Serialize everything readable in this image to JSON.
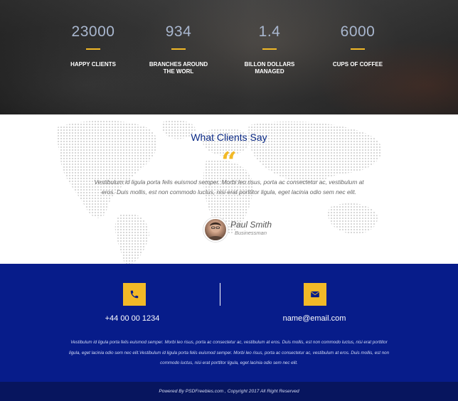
{
  "stats": [
    {
      "value": "23000",
      "label": "HAPPY CLIENTS"
    },
    {
      "value": "934",
      "label": "BRANCHES AROUND\nTHE WORL"
    },
    {
      "value": "1.4",
      "label": "BILLON DOLLARS\nMANAGED"
    },
    {
      "value": "6000",
      "label": "CUPS OF COFFEE"
    }
  ],
  "testimonials": {
    "title": "What Clients Say",
    "quote_icon": "quote-icon",
    "text": "Vestibulum id ligula porta felis euismod semper. Morbi leo risus, porta ac consectetur ac, vestibulum at eros. Duis mollis, est non commodo luctus, nisi erat porttitor ligula, eget lacinia odio sem nec elit.",
    "person": {
      "name": "Paul Smith",
      "role": "Businessman"
    }
  },
  "contact": {
    "phone": "+44 00 00 1234",
    "email": "name@email.com",
    "phone_icon": "phone-icon",
    "email_icon": "envelope-icon",
    "text": "Vestibulum id ligula porta felis euismod semper. Morbi leo risus, porta ac consectetur ac, vestibulum at eros. Duis mollis, est non commodo luctus, nisi erat porttitor ligula, eget lacinia odio sem nec elit.Vestibulum id ligula porta felis euismod semper. Morbi leo risus, porta ac consectetur ac, vestibulum at eros. Duis mollis, est non commodo luctus, nisi erat porttitor ligula, eget lacinia odio sem nec elit."
  },
  "footer": {
    "text": "Powered By PSDFreebies.com , Copyright 2017 All Right Reserved"
  },
  "colors": {
    "accent": "#f2b927",
    "navy": "#071c8a",
    "footer_bg": "#07155e",
    "title_blue": "#0b2a86"
  }
}
